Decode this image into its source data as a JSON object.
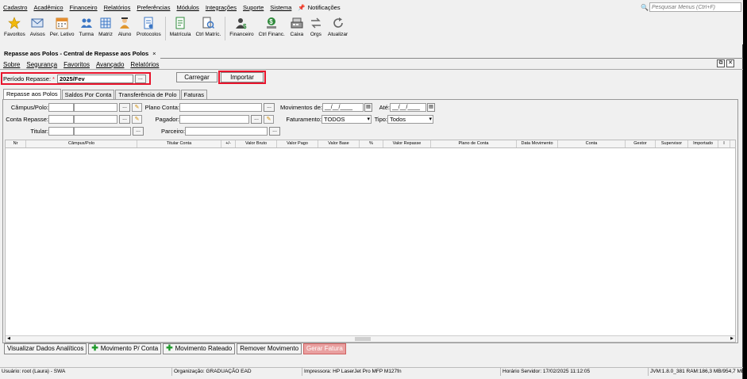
{
  "menu": {
    "items": [
      "Cadastro",
      "Acadêmico",
      "Financeiro",
      "Relatórios",
      "Preferências",
      "Módulos",
      "Integrações",
      "Suporte",
      "Sistema"
    ],
    "notifications_label": "Notificações",
    "search_placeholder": "Pesquisar Menus (Ctrl+F)"
  },
  "toolbar": [
    {
      "label": "Favoritos",
      "icon": "star-icon"
    },
    {
      "label": "Avisos",
      "icon": "envelope-icon"
    },
    {
      "label": "Per. Letivo",
      "icon": "calendar-icon"
    },
    {
      "label": "Turma",
      "icon": "group-icon"
    },
    {
      "label": "Matriz",
      "icon": "matrix-icon"
    },
    {
      "label": "Aluno",
      "icon": "student-icon"
    },
    {
      "label": "Protocolos",
      "icon": "protocol-icon"
    },
    {
      "label": "Matrícula",
      "icon": "enrollment-icon"
    },
    {
      "label": "Ctrl Matríc.",
      "icon": "enrollment-control-icon"
    },
    {
      "label": "Financeiro",
      "icon": "finance-icon"
    },
    {
      "label": "Ctrl Financ.",
      "icon": "finance-control-icon"
    },
    {
      "label": "Caixa",
      "icon": "cash-register-icon"
    },
    {
      "label": "Orgs",
      "icon": "orgs-icon"
    },
    {
      "label": "Atualizar",
      "icon": "refresh-icon"
    }
  ],
  "doc_tab": {
    "title": "Repasse aos Polos - Central de Repasse aos Polos",
    "close": "×"
  },
  "submenu": [
    "Sobre",
    "Segurança",
    "Favoritos",
    "Avançado",
    "Relatórios"
  ],
  "period": {
    "label": "Período Repasse:",
    "required": "*",
    "value": "2025/Fev",
    "browse": "..."
  },
  "buttons": {
    "carregar": "Carregar",
    "importar": "Importar"
  },
  "tabs": [
    "Repasse aos Polos",
    "Saldos Por Conta",
    "Transferência de Polo",
    "Faturas"
  ],
  "filters": {
    "campus_label": "Câmpus/Polo:",
    "conta_repasse_label": "Conta Repasse:",
    "titular_label": "Titular:",
    "plano_conta_label": "Plano Conta:",
    "pagador_label": "Pagador:",
    "parceiro_label": "Parceiro:",
    "movimentos_label": "Movimentos de:",
    "movimentos_value": "__/__/____",
    "ate_label": "Até:",
    "ate_value": "__/__/____",
    "faturamento_label": "Faturamento:",
    "faturamento_value": "TODOS",
    "tipo_label": "Tipo:",
    "tipo_value": "Todos",
    "browse": "..."
  },
  "grid": {
    "columns": [
      "Nr",
      "Câmpus/Polo",
      "Titular Conta",
      "+/-",
      "Valor Bruto",
      "Valor Pago",
      "Valor Base",
      "%",
      "Valor Repasse",
      "Plano de Conta",
      "Data Movimento",
      "Conta",
      "Gestor",
      "Supervisor",
      "Importado",
      "I"
    ],
    "rows": []
  },
  "actions": {
    "visualizar": "Visualizar Dados Analíticos",
    "movimento_conta": "Movimento P/ Conta",
    "movimento_rateado": "Movimento Rateado",
    "remover": "Remover Movimento",
    "gerar_fatura": "Gerar Fatura"
  },
  "status": {
    "usuario": "Usuário: root (Laura) - SWA",
    "organizacao": "Organização: GRADUAÇÃO EAD",
    "impressora": "Impressora: HP LaserJet Pro MFP M127fn",
    "horario": "Horário Servidor: 17/02/2025 11:12:05",
    "jvm": "JVM:1.8.0_381  RAM:186,3 MB/954,7 MB"
  },
  "colors": {
    "highlight": "#e8142c",
    "add": "#1e9a2a"
  }
}
